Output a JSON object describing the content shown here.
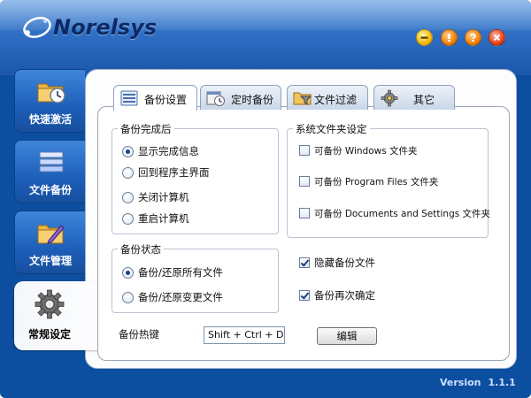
{
  "app": {
    "brand": "Norelsys",
    "version_label": "Version",
    "version_number": "1.1.1"
  },
  "window_buttons": [
    "minimize-icon",
    "warning-icon",
    "help-icon",
    "close-icon"
  ],
  "sidebar": {
    "items": [
      {
        "label": "快速激活",
        "icon": "folder-clock-icon"
      },
      {
        "label": "文件备份",
        "icon": "stack-icon"
      },
      {
        "label": "文件管理",
        "icon": "folder-pen-icon"
      },
      {
        "label": "常规设定",
        "icon": "gear-icon",
        "active": true
      }
    ]
  },
  "tabs": [
    {
      "label": "备份设置",
      "icon": "list-icon",
      "active": true
    },
    {
      "label": "定时备份",
      "icon": "calendar-clock-icon"
    },
    {
      "label": "文件过滤",
      "icon": "folder-filter-icon"
    },
    {
      "label": "其它",
      "icon": "gear-icon"
    }
  ],
  "backup_complete": {
    "title": "备份完成后",
    "options": [
      {
        "label": "显示完成信息",
        "selected": true
      },
      {
        "label": "回到程序主界面",
        "selected": false
      },
      {
        "label": "关闭计算机",
        "selected": false
      },
      {
        "label": "重启计算机",
        "selected": false
      }
    ]
  },
  "backup_status": {
    "title": "备份状态",
    "options": [
      {
        "label": "备份/还原所有文件",
        "selected": true
      },
      {
        "label": "备份/还原变更文件",
        "selected": false
      }
    ]
  },
  "system_folders": {
    "title": "系统文件夹设定",
    "options": [
      {
        "label": "可备份 Windows 文件夹",
        "checked": false
      },
      {
        "label": "可备份 Program Files 文件夹",
        "checked": false
      },
      {
        "label": "可备份 Documents and Settings 文件夹",
        "checked": false
      }
    ]
  },
  "extra_options": [
    {
      "label": "隐藏备份文件",
      "checked": true
    },
    {
      "label": "备份再次确定",
      "checked": true
    }
  ],
  "hotkey": {
    "label": "备份热键",
    "value": "Shift + Ctrl + D",
    "edit_label": "编辑"
  },
  "colors": {
    "frame": "#0c4fa0",
    "header_top": "#5f9be0",
    "sidebar": "#1d5fb9",
    "radio_dot": "#1c3f8a"
  }
}
